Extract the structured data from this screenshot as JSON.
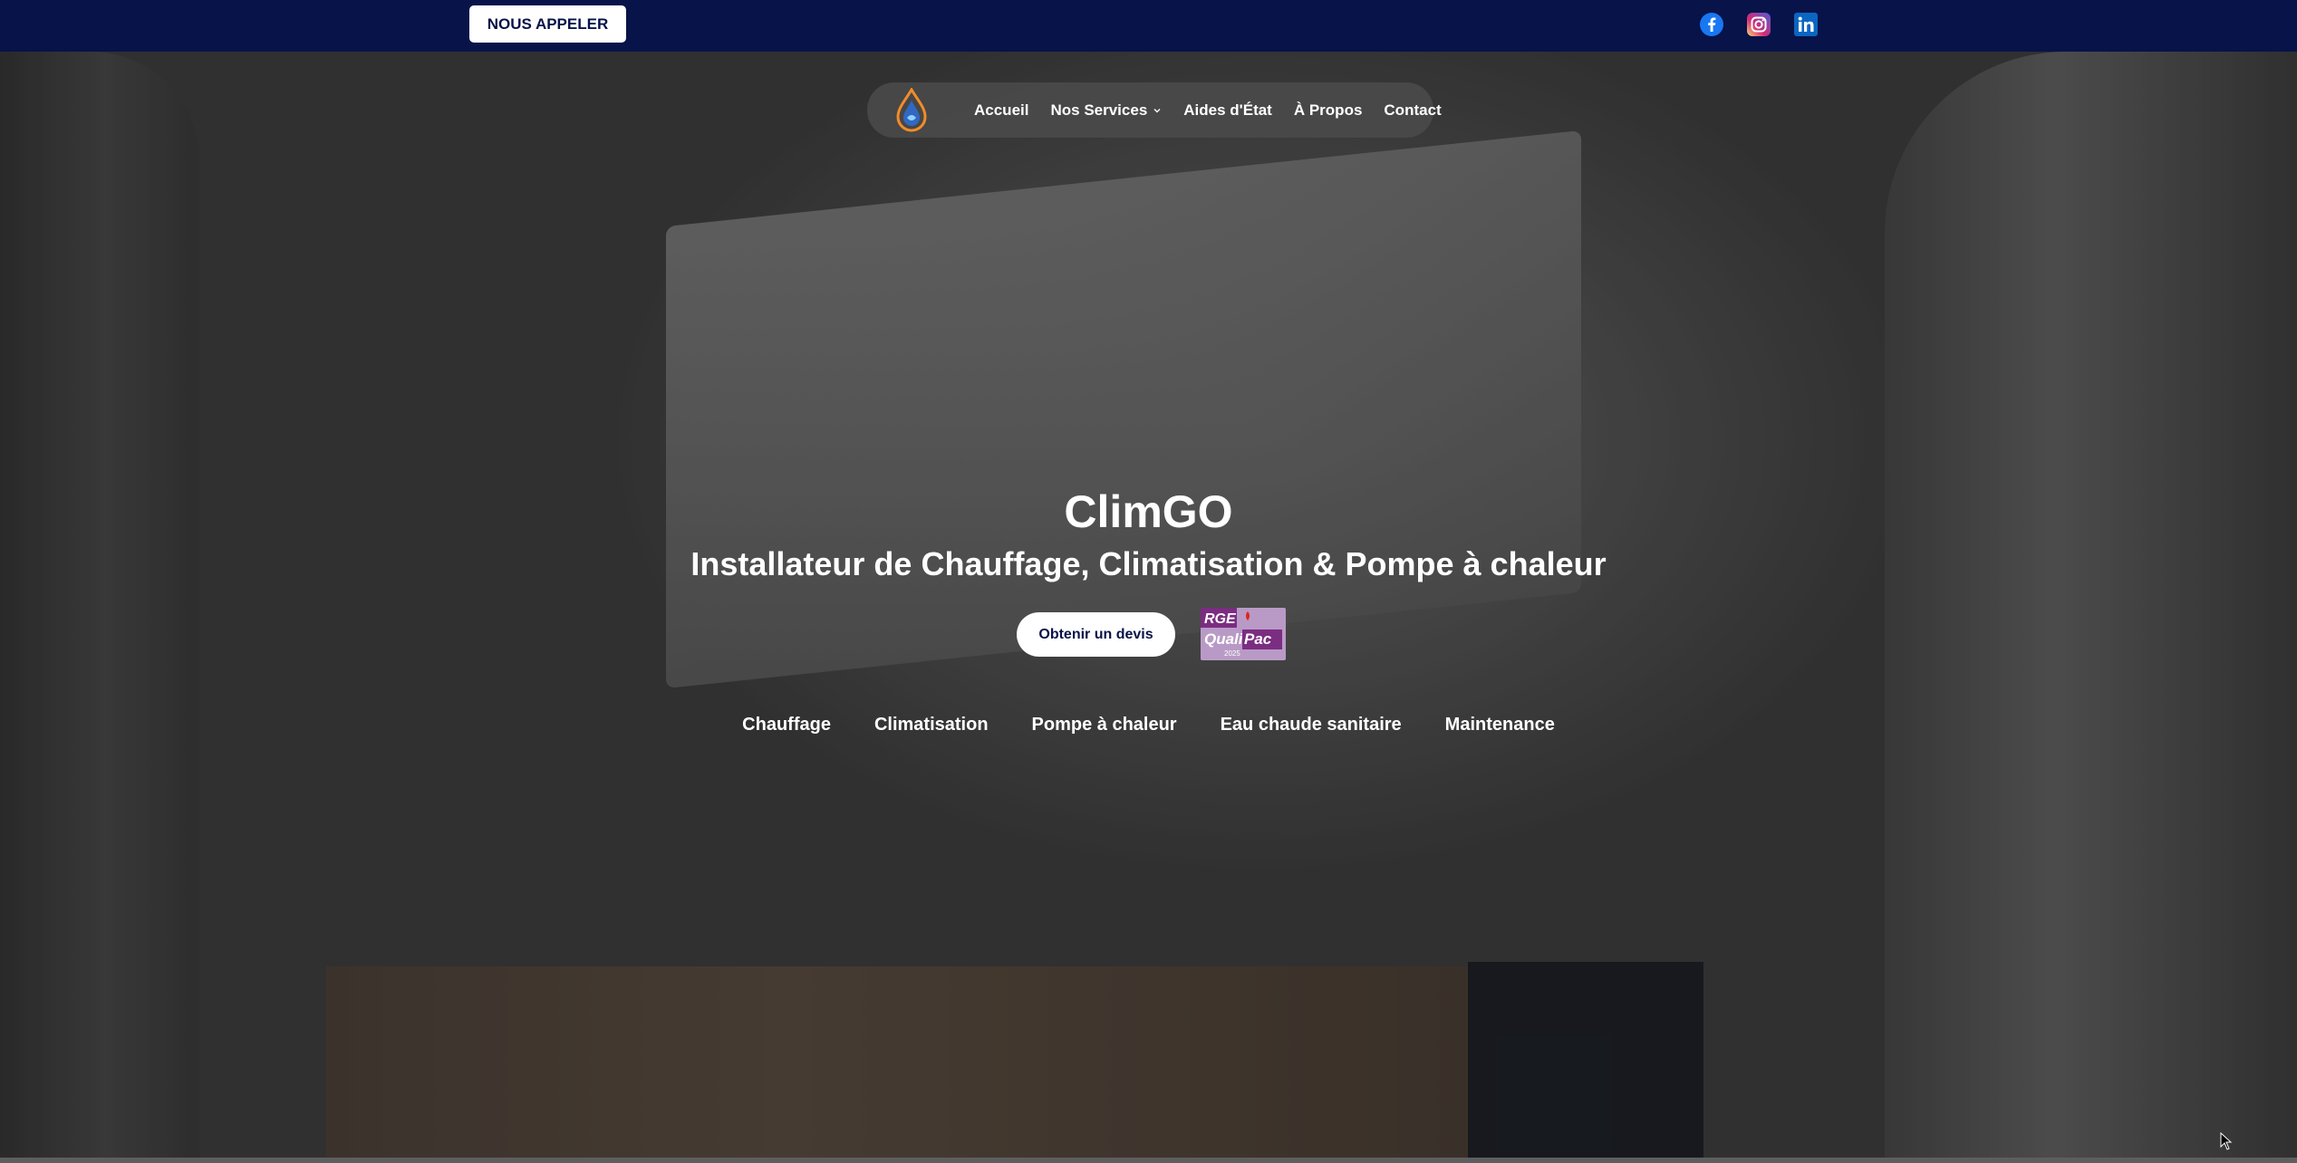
{
  "topbar": {
    "call_button": "NOUS APPELER",
    "socials": [
      {
        "name": "facebook-icon",
        "color": "#1877F2"
      },
      {
        "name": "instagram-icon",
        "color": "#E1306C"
      },
      {
        "name": "linkedin-icon",
        "color": "#0A66C2"
      }
    ]
  },
  "nav": {
    "logo_icon": "droplet-flame-logo",
    "items": [
      {
        "label": "Accueil"
      },
      {
        "label": "Nos Services",
        "has_dropdown": true
      },
      {
        "label": "Aides d'État"
      },
      {
        "label": "À Propos"
      },
      {
        "label": "Contact"
      }
    ]
  },
  "hero": {
    "title": "ClimGO",
    "subtitle": "Installateur de Chauffage, Climatisation & Pompe à chaleur",
    "cta_label": "Obtenir un devis",
    "badge_alt": "RGE QualiPac 2025",
    "services": [
      "Chauffage",
      "Climatisation",
      "Pompe à chaleur",
      "Eau chaude sanitaire",
      "Maintenance"
    ]
  },
  "colors": {
    "brand_navy": "#071349",
    "white": "#FFFFFF",
    "badge_purple": "#7B2D82"
  }
}
